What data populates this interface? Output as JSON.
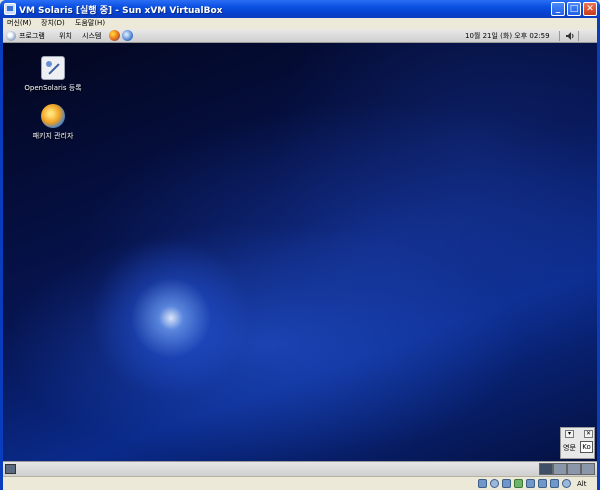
{
  "window": {
    "title": "VM Solaris [실행 중] - Sun xVM VirtualBox",
    "minimize_glyph": "_",
    "maximize_glyph": "□",
    "close_glyph": "✕"
  },
  "menu": {
    "items": [
      {
        "label": "머신(M)"
      },
      {
        "label": "장치(D)"
      },
      {
        "label": "도움말(H)"
      }
    ]
  },
  "top_panel": {
    "menus": [
      {
        "label": "프로그램"
      },
      {
        "label": "위치"
      },
      {
        "label": "시스템"
      }
    ],
    "clock": "10월 21일 (화) 오후 02:59"
  },
  "desktop": {
    "icons": [
      {
        "label": "OpenSolaris 등록",
        "icon": "registration-icon"
      },
      {
        "label": "패키지 관리자",
        "icon": "package-manager-icon"
      }
    ]
  },
  "ime_bar": {
    "lang_label": "영문",
    "mode_label": "Ko"
  },
  "statusbar": {
    "host_key": "Alt",
    "icons": [
      "hard-disk-icon",
      "cd-icon",
      "floppy-icon",
      "network-icon",
      "usb-icon",
      "shared-folders-icon",
      "display-icon",
      "mouse-integration-icon"
    ]
  }
}
